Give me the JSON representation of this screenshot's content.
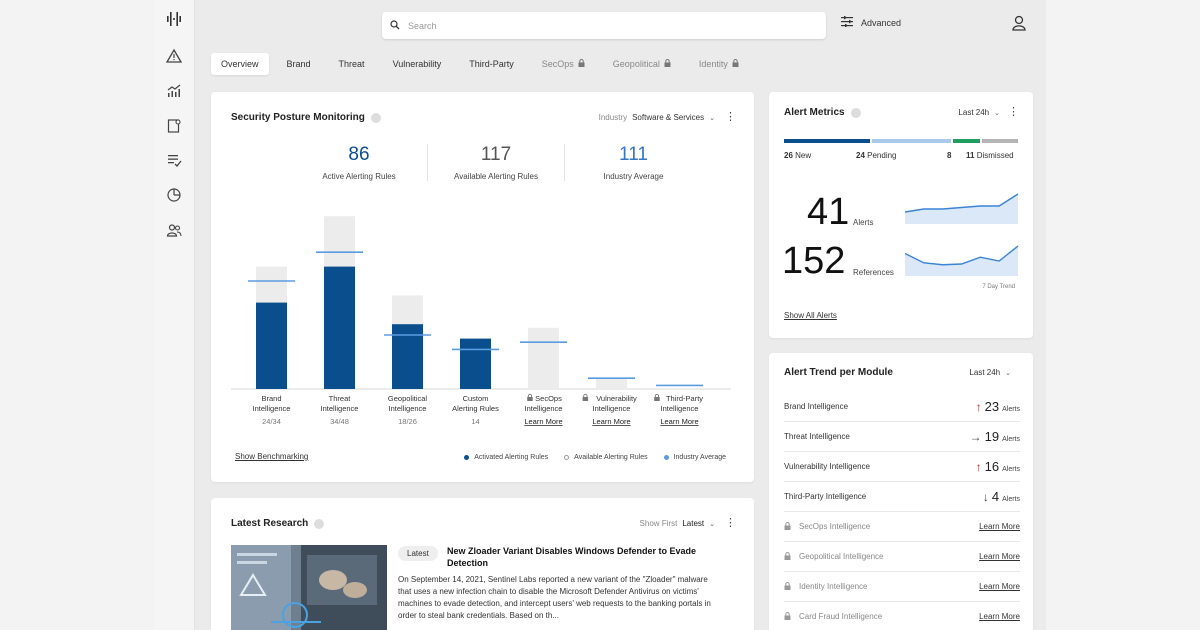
{
  "search": {
    "placeholder": "Search"
  },
  "toolbar": {
    "advanced_label": "Advanced"
  },
  "tabs": [
    {
      "label": "Overview",
      "active": true,
      "locked": false
    },
    {
      "label": "Brand",
      "active": false,
      "locked": false
    },
    {
      "label": "Threat",
      "active": false,
      "locked": false
    },
    {
      "label": "Vulnerability",
      "active": false,
      "locked": false
    },
    {
      "label": "Third-Party",
      "active": false,
      "locked": false
    },
    {
      "label": "SecOps",
      "active": false,
      "locked": true
    },
    {
      "label": "Geopolitical",
      "active": false,
      "locked": true
    },
    {
      "label": "Identity",
      "active": false,
      "locked": true
    }
  ],
  "posture": {
    "title": "Security Posture Monitoring",
    "industry_label": "Industry",
    "industry_value": "Software & Services",
    "stats": [
      {
        "value": "86",
        "label": "Active Alerting Rules"
      },
      {
        "value": "117",
        "label": "Available Alerting Rules"
      },
      {
        "value": "111",
        "label": "Industry Average"
      }
    ],
    "show_benchmarking": "Show Benchmarking",
    "legend": {
      "activated": "Activated Alerting Rules",
      "available": "Available Alerting Rules",
      "average": "Industry Average"
    }
  },
  "chart_data": {
    "type": "bar",
    "categories": [
      "Brand Intelligence",
      "Threat Intelligence",
      "Geopolitical Intelligence",
      "Custom Alerting Rules",
      "SecOps Intelligence",
      "Vulnerability Intelligence",
      "Third-Party Intelligence"
    ],
    "category_lines": [
      [
        "Brand",
        "Intelligence"
      ],
      [
        "Threat",
        "Intelligence"
      ],
      [
        "Geopolitical",
        "Intelligence"
      ],
      [
        "Custom",
        "Alerting Rules"
      ],
      [
        "SecOps",
        "Intelligence"
      ],
      [
        "Vulnerability",
        "Intelligence"
      ],
      [
        "Third-Party",
        "Intelligence"
      ]
    ],
    "sub_labels": [
      "24/34",
      "34/48",
      "18/26",
      "14",
      "Learn More",
      "Learn More",
      "Learn More"
    ],
    "locked": [
      false,
      false,
      false,
      false,
      true,
      true,
      true
    ],
    "series": [
      {
        "name": "Activated Alerting Rules",
        "values": [
          24,
          34,
          18,
          14,
          0,
          0,
          0
        ]
      },
      {
        "name": "Available Alerting Rules",
        "values": [
          34,
          48,
          26,
          14,
          17,
          3,
          0
        ]
      },
      {
        "name": "Industry Average",
        "values": [
          30,
          38,
          15,
          11,
          13,
          3,
          1
        ]
      }
    ],
    "ylim": [
      0,
      50
    ],
    "colors": {
      "activated": "#0b4e8e",
      "available": "#ececec",
      "average": "#5b9be0"
    }
  },
  "metrics": {
    "title": "Alert Metrics",
    "period": "Last 24h",
    "segments": [
      {
        "count": "26",
        "label": "New",
        "value": 26,
        "color": "#0b4e8e"
      },
      {
        "count": "24",
        "label": "Pending",
        "value": 24,
        "color": "#a9c8ea"
      },
      {
        "count": "8",
        "label": "",
        "value": 8,
        "color": "#1f9e5f"
      },
      {
        "count": "11",
        "label": "Dismissed",
        "value": 11,
        "color": "#b5b5b5"
      }
    ],
    "alerts_count": "41",
    "alerts_label": "Alerts",
    "refs_count": "152",
    "refs_label": "References",
    "trend_caption": "7 Day Trend",
    "alerts_trend": [
      4,
      5,
      5,
      5.5,
      6,
      6,
      10
    ],
    "refs_trend": [
      6,
      3.5,
      3,
      3.2,
      5,
      4,
      8
    ],
    "show_all": "Show All Alerts"
  },
  "trend": {
    "title": "Alert Trend per Module",
    "period": "Last 24h",
    "rows": [
      {
        "name": "Brand Intelligence",
        "direction": "up",
        "arrow": "↑",
        "count": "23",
        "unit": "Alerts",
        "locked": false
      },
      {
        "name": "Threat Intelligence",
        "direction": "flat",
        "arrow": "→",
        "count": "19",
        "unit": "Alerts",
        "locked": false
      },
      {
        "name": "Vulnerability Intelligence",
        "direction": "up",
        "arrow": "↑",
        "count": "16",
        "unit": "Alerts",
        "locked": false
      },
      {
        "name": "Third-Party Intelligence",
        "direction": "down",
        "arrow": "↓",
        "count": "4",
        "unit": "Alerts",
        "locked": false
      },
      {
        "name": "SecOps Intelligence",
        "locked": true,
        "link": "Learn More"
      },
      {
        "name": "Geopolitical Intelligence",
        "locked": true,
        "link": "Learn More"
      },
      {
        "name": "Identity Intelligence",
        "locked": true,
        "link": "Learn More"
      },
      {
        "name": "Card Fraud Intelligence",
        "locked": true,
        "link": "Learn More"
      }
    ]
  },
  "research": {
    "title": "Latest Research",
    "show_first_label": "Show First",
    "show_first_value": "Latest",
    "badge": "Latest",
    "article_title": "New Zloader Variant Disables Windows Defender to Evade Detection",
    "article_body": "On September 14, 2021, Sentinel Labs reported a new variant of the \"Zloader\" malware that uses a new infection chain to disable the Microsoft Defender Antivirus on victims' machines to evade detection, and intercept users' web requests to the banking portals in order to steal bank credentials. Based on th..."
  }
}
